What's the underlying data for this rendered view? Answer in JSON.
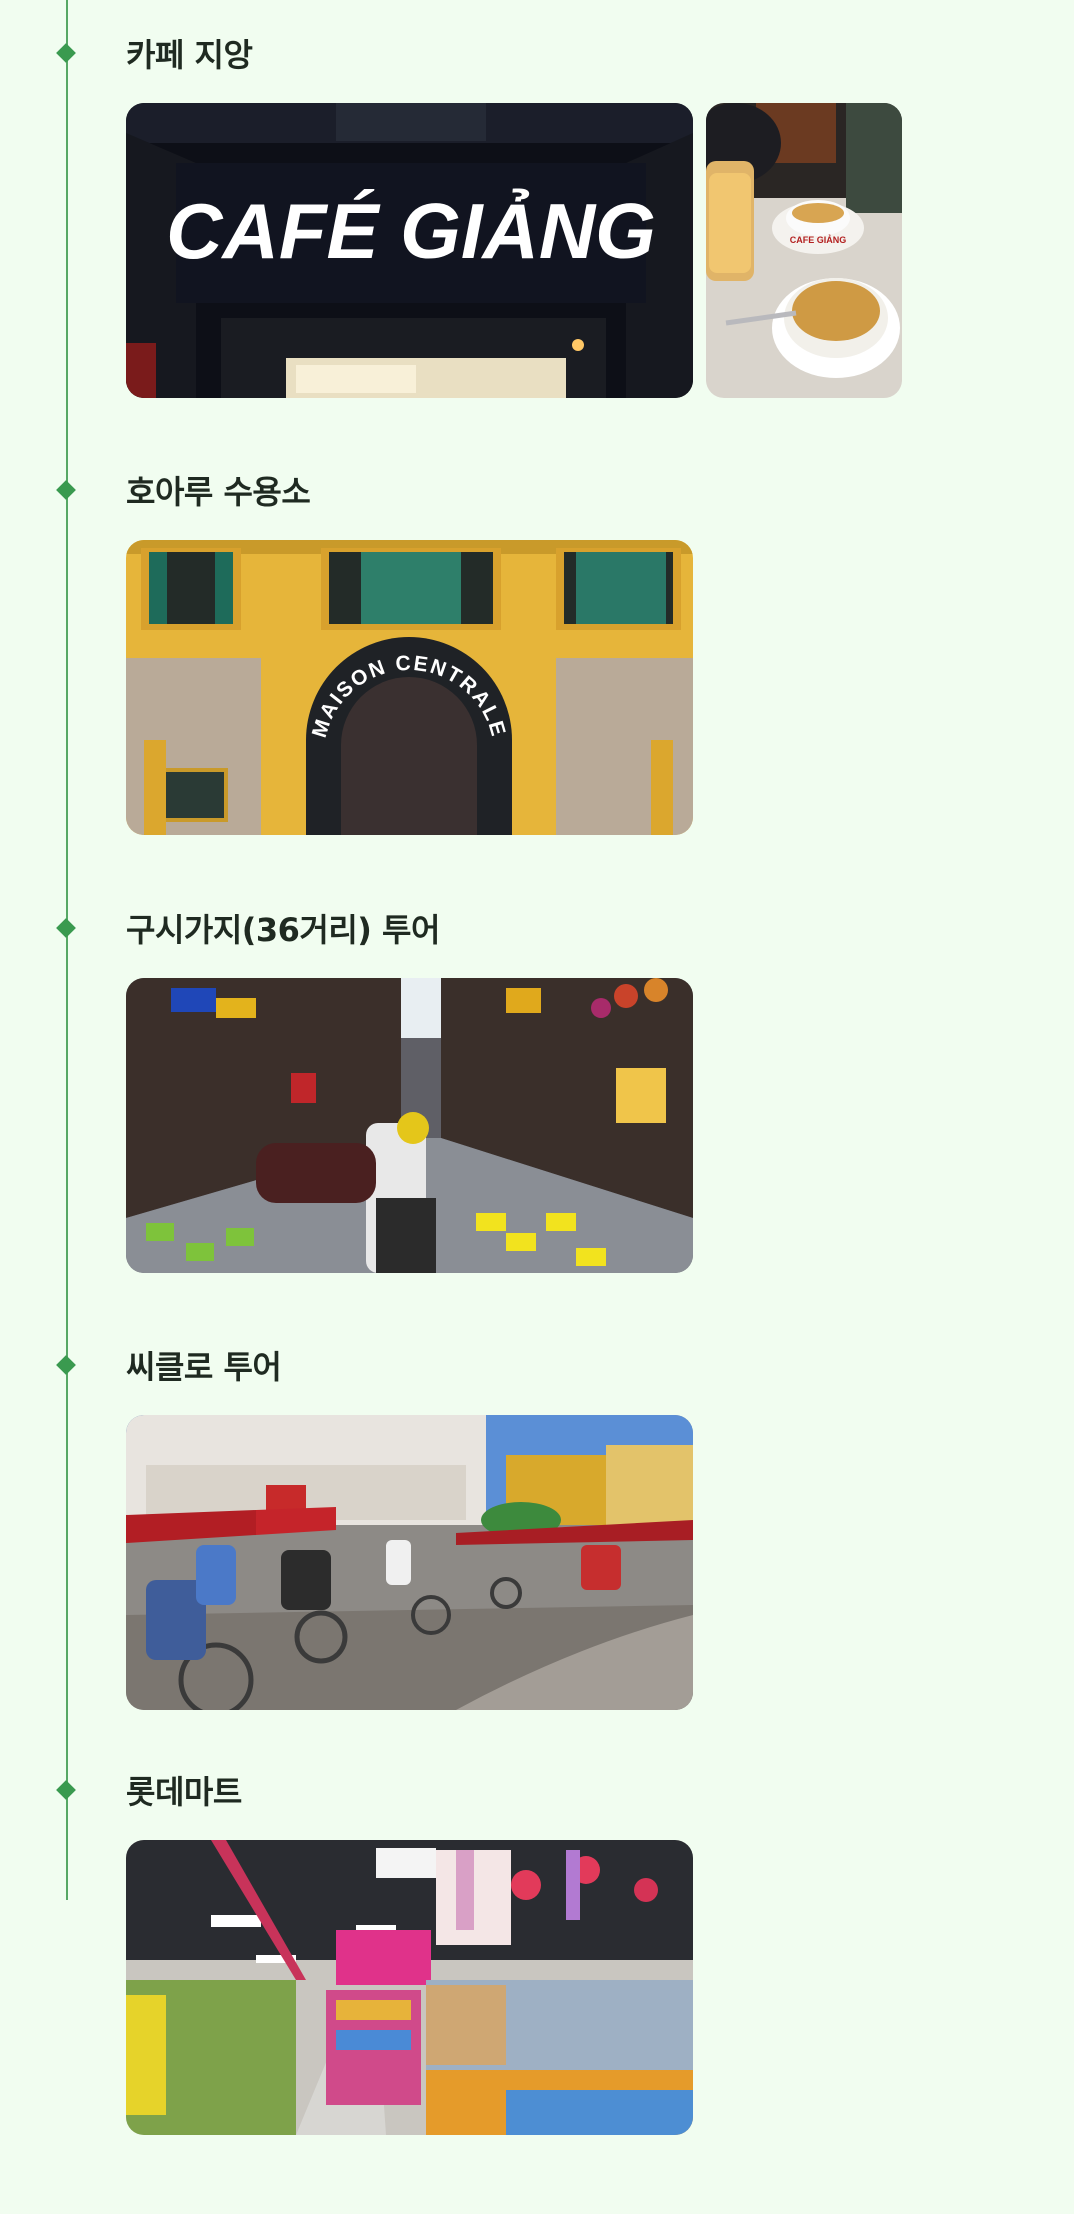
{
  "timeline": {
    "stops": [
      {
        "title": "카페 지앙",
        "photos": [
          "cafe-giang-storefront",
          "egg-coffee-cups"
        ],
        "sign": "CAFÉ GIẢNG",
        "cup_label": "CAFE GIẢNG"
      },
      {
        "title": "호아루 수용소",
        "photos": [
          "maison-centrale-gate"
        ],
        "sign": "MAISON CENTRALE"
      },
      {
        "title": "구시가지(36거리) 투어",
        "photos": [
          "old-quarter-street"
        ]
      },
      {
        "title": "씨클로 투어",
        "photos": [
          "cyclo-square"
        ]
      },
      {
        "title": "롯데마트",
        "photos": [
          "lotte-mart-aisle"
        ]
      }
    ]
  },
  "colors": {
    "background": "#f1fdf0",
    "line": "#57a865",
    "marker": "#3a9a4f",
    "title": "#1f2a21"
  }
}
